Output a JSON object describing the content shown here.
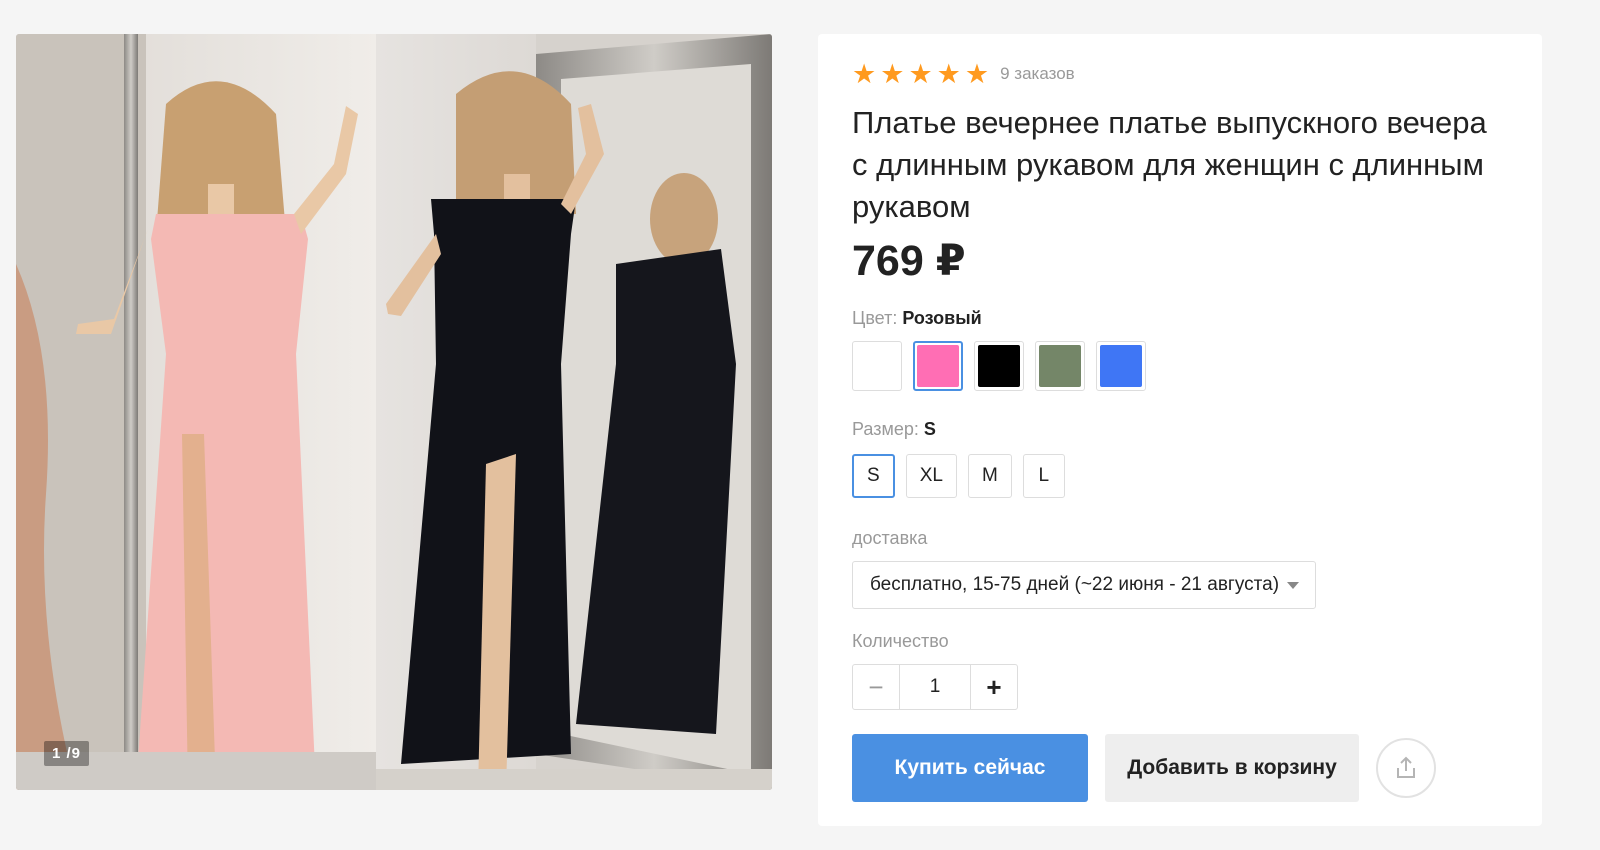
{
  "gallery": {
    "counter": "1 /9"
  },
  "product": {
    "stars": [
      "★",
      "★",
      "★",
      "★",
      "★"
    ],
    "star_color": "#ff9a1f",
    "orders": "9 заказов",
    "title": "Платье вечернее платье выпускного вечера с длинным рукавом для женщин с длинным рукавом",
    "price": "769 ₽"
  },
  "color": {
    "label": "Цвет:",
    "selected": "Розовый",
    "swatches": [
      {
        "name": "white",
        "hex": "#ffffff"
      },
      {
        "name": "pink",
        "hex": "#ff6eb4"
      },
      {
        "name": "black",
        "hex": "#000000"
      },
      {
        "name": "olive",
        "hex": "#748668"
      },
      {
        "name": "blue",
        "hex": "#3f76f5"
      }
    ]
  },
  "size": {
    "label": "Размер:",
    "selected": "S",
    "options": [
      "S",
      "XL",
      "M",
      "L"
    ]
  },
  "delivery": {
    "label": "доставка",
    "value": "бесплатно, 15-75 дней (~22 июня - 21 августа)"
  },
  "quantity": {
    "label": "Количество",
    "minus": "−",
    "value": "1",
    "plus": "+"
  },
  "actions": {
    "buy": "Купить сейчас",
    "cart": "Добавить в корзину",
    "accent": "#4a90e2"
  }
}
